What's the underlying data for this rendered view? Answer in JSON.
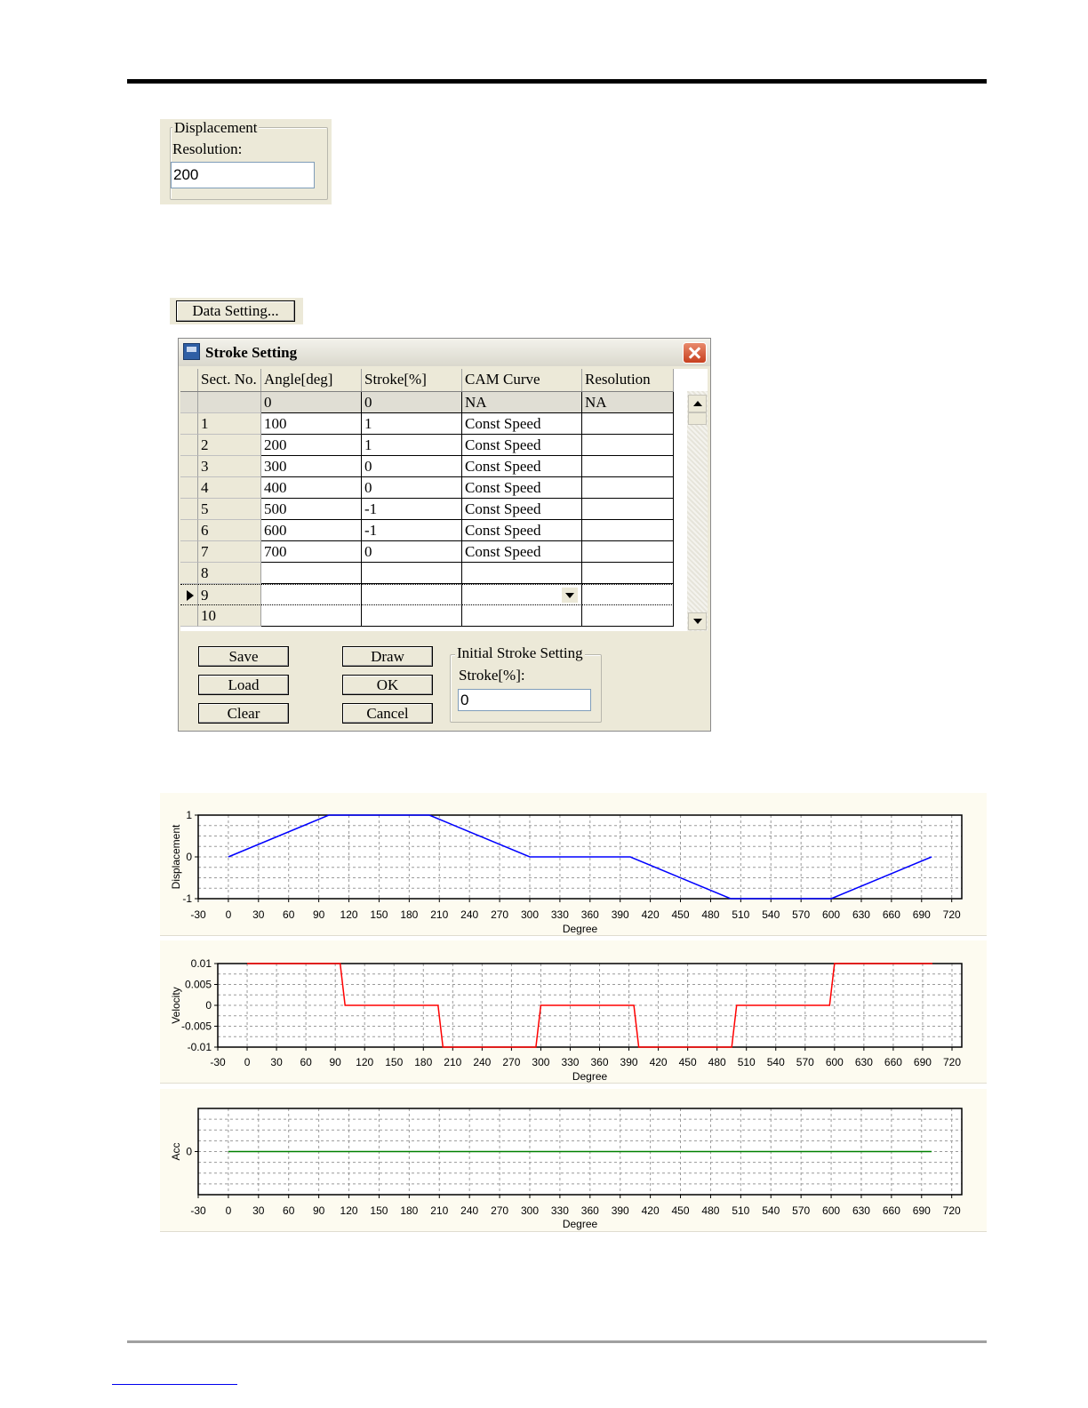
{
  "displacement": {
    "group_title": "Displacement",
    "resolution_label": "Resolution:",
    "resolution_value": "200"
  },
  "data_setting_button": "Data Setting...",
  "dialog": {
    "title": "Stroke Setting",
    "columns": [
      "Sect. No.",
      "Angle[deg]",
      "Stroke[%]",
      "CAM Curve",
      "Resolution"
    ],
    "rows": [
      [
        "",
        "0",
        "0",
        "NA",
        "NA"
      ],
      [
        "1",
        "100",
        "1",
        "Const Speed",
        ""
      ],
      [
        "2",
        "200",
        "1",
        "Const Speed",
        ""
      ],
      [
        "3",
        "300",
        "0",
        "Const Speed",
        ""
      ],
      [
        "4",
        "400",
        "0",
        "Const Speed",
        ""
      ],
      [
        "5",
        "500",
        "-1",
        "Const Speed",
        ""
      ],
      [
        "6",
        "600",
        "-1",
        "Const Speed",
        ""
      ],
      [
        "7",
        "700",
        "0",
        "Const Speed",
        ""
      ],
      [
        "8",
        "",
        "",
        "",
        ""
      ],
      [
        "9",
        "",
        "",
        "",
        ""
      ],
      [
        "10",
        "",
        "",
        "",
        ""
      ]
    ],
    "current_row": 9,
    "buttons": {
      "save": "Save",
      "load": "Load",
      "clear": "Clear",
      "draw": "Draw",
      "ok": "OK",
      "cancel": "Cancel"
    },
    "initial_stroke": {
      "group_title": "Initial Stroke Setting",
      "label": "Stroke[%]:",
      "value": "0"
    }
  },
  "chart_data": [
    {
      "type": "line",
      "xlabel": "Degree",
      "ylabel": "Displacement",
      "xlim": [
        -30,
        730
      ],
      "ylim": [
        -1,
        1
      ],
      "x_ticks": [
        -30,
        0,
        30,
        60,
        90,
        120,
        150,
        180,
        210,
        240,
        270,
        300,
        330,
        360,
        390,
        420,
        450,
        480,
        510,
        540,
        570,
        600,
        630,
        660,
        690,
        720
      ],
      "y_ticks": [
        -1,
        0,
        1
      ],
      "y_tick_labels": [
        "-1",
        "0",
        "1"
      ],
      "grid": true,
      "color": "#0000ff",
      "x": [
        0,
        100,
        200,
        300,
        400,
        500,
        600,
        700
      ],
      "y": [
        0,
        1,
        1,
        0,
        0,
        -1,
        -1,
        0
      ]
    },
    {
      "type": "line",
      "xlabel": "Degree",
      "ylabel": "Velocity",
      "xlim": [
        -30,
        730
      ],
      "ylim": [
        -0.01,
        0.01
      ],
      "x_ticks": [
        -30,
        0,
        30,
        60,
        90,
        120,
        150,
        180,
        210,
        240,
        270,
        300,
        330,
        360,
        390,
        420,
        450,
        480,
        510,
        540,
        570,
        600,
        630,
        660,
        690,
        720
      ],
      "y_ticks": [
        -0.01,
        -0.005,
        0,
        0.005,
        0.01
      ],
      "y_tick_labels": [
        "-0.01",
        "-0.005",
        "0",
        "0.005",
        "0.01"
      ],
      "grid": true,
      "color": "#ff0000",
      "x": [
        0,
        95,
        100,
        195,
        200,
        295,
        300,
        395,
        400,
        495,
        500,
        595,
        600,
        700
      ],
      "y": [
        0.01,
        0.01,
        0,
        0,
        -0.01,
        -0.01,
        0,
        0,
        -0.01,
        -0.01,
        0,
        0,
        0.01,
        0.01
      ]
    },
    {
      "type": "line",
      "xlabel": "Degree",
      "ylabel": "Acc",
      "xlim": [
        -30,
        730
      ],
      "ylim": [
        -1,
        1
      ],
      "x_ticks": [
        -30,
        0,
        30,
        60,
        90,
        120,
        150,
        180,
        210,
        240,
        270,
        300,
        330,
        360,
        390,
        420,
        450,
        480,
        510,
        540,
        570,
        600,
        630,
        660,
        690,
        720
      ],
      "y_ticks": [
        0
      ],
      "y_tick_labels": [
        "0"
      ],
      "grid": true,
      "color": "#008000",
      "x": [
        0,
        700
      ],
      "y": [
        0,
        0
      ]
    }
  ]
}
